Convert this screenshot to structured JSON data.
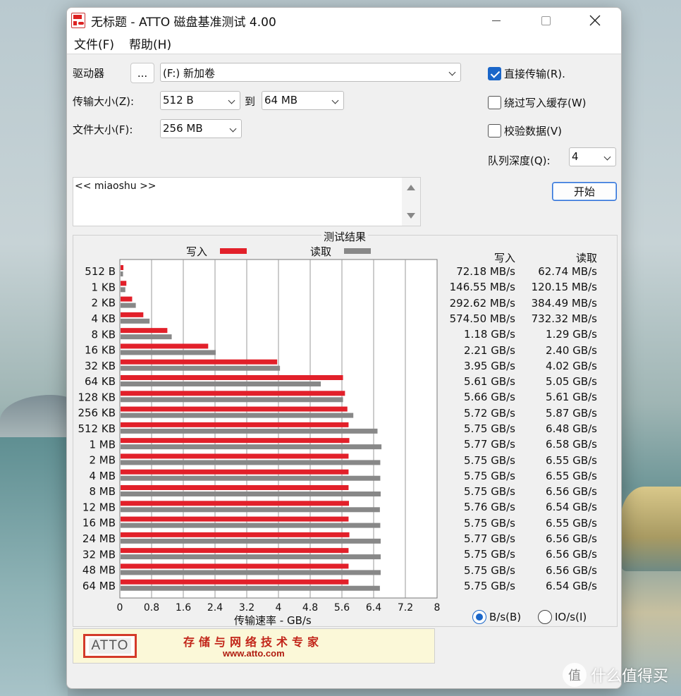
{
  "window": {
    "title": "无标题 - ATTO 磁盘基准测试 4.00"
  },
  "menu": [
    "文件(F)",
    "帮助(H)"
  ],
  "settings": {
    "drive_label": "驱动器",
    "drive_browse": "...",
    "drive_value": "(F:) 新加卷",
    "transfer_label": "传输大小(Z):",
    "transfer_from": "512 B",
    "transfer_to_label": "到",
    "transfer_to": "64 MB",
    "filesize_label": "文件大小(F):",
    "filesize_value": "256 MB",
    "direct_io": {
      "label": "直接传输(R).",
      "checked": true
    },
    "bypass_cache": {
      "label": "绕过写入缓存(W)",
      "checked": false
    },
    "verify": {
      "label": "校验数据(V)",
      "checked": false
    },
    "queue_label": "队列深度(Q):",
    "queue_value": "4",
    "start_label": "开始",
    "description": "<< miaoshu >>"
  },
  "results": {
    "title": "测试结果",
    "legend_write": "写入",
    "legend_read": "读取",
    "col_write": "写入",
    "col_read": "读取",
    "xlabel": "传输速率 - GB/s",
    "write_color": "#e2202a",
    "read_color": "#888888",
    "rows": [
      {
        "size": "512 B",
        "write": "72.18 MB/s",
        "read": "62.74 MB/s"
      },
      {
        "size": "1 KB",
        "write": "146.55 MB/s",
        "read": "120.15 MB/s"
      },
      {
        "size": "2 KB",
        "write": "292.62 MB/s",
        "read": "384.49 MB/s"
      },
      {
        "size": "4 KB",
        "write": "574.50 MB/s",
        "read": "732.32 MB/s"
      },
      {
        "size": "8 KB",
        "write": "1.18 GB/s",
        "read": "1.29 GB/s"
      },
      {
        "size": "16 KB",
        "write": "2.21 GB/s",
        "read": "2.40 GB/s"
      },
      {
        "size": "32 KB",
        "write": "3.95 GB/s",
        "read": "4.02 GB/s"
      },
      {
        "size": "64 KB",
        "write": "5.61 GB/s",
        "read": "5.05 GB/s"
      },
      {
        "size": "128 KB",
        "write": "5.66 GB/s",
        "read": "5.61 GB/s"
      },
      {
        "size": "256 KB",
        "write": "5.72 GB/s",
        "read": "5.87 GB/s"
      },
      {
        "size": "512 KB",
        "write": "5.75 GB/s",
        "read": "6.48 GB/s"
      },
      {
        "size": "1 MB",
        "write": "5.77 GB/s",
        "read": "6.58 GB/s"
      },
      {
        "size": "2 MB",
        "write": "5.75 GB/s",
        "read": "6.55 GB/s"
      },
      {
        "size": "4 MB",
        "write": "5.75 GB/s",
        "read": "6.55 GB/s"
      },
      {
        "size": "8 MB",
        "write": "5.75 GB/s",
        "read": "6.56 GB/s"
      },
      {
        "size": "12 MB",
        "write": "5.76 GB/s",
        "read": "6.54 GB/s"
      },
      {
        "size": "16 MB",
        "write": "5.75 GB/s",
        "read": "6.55 GB/s"
      },
      {
        "size": "24 MB",
        "write": "5.77 GB/s",
        "read": "6.56 GB/s"
      },
      {
        "size": "32 MB",
        "write": "5.75 GB/s",
        "read": "6.56 GB/s"
      },
      {
        "size": "48 MB",
        "write": "5.75 GB/s",
        "read": "6.56 GB/s"
      },
      {
        "size": "64 MB",
        "write": "5.75 GB/s",
        "read": "6.54 GB/s"
      }
    ],
    "unit_bytes": {
      "label": "B/s(B)",
      "selected": true
    },
    "unit_io": {
      "label": "IO/s(I)",
      "selected": false
    }
  },
  "chart_data": {
    "type": "bar",
    "orientation": "horizontal",
    "categories": [
      "512 B",
      "1 KB",
      "2 KB",
      "4 KB",
      "8 KB",
      "16 KB",
      "32 KB",
      "64 KB",
      "128 KB",
      "256 KB",
      "512 KB",
      "1 MB",
      "2 MB",
      "4 MB",
      "8 MB",
      "12 MB",
      "16 MB",
      "24 MB",
      "32 MB",
      "48 MB",
      "64 MB"
    ],
    "series": [
      {
        "name": "写入",
        "values": [
          0.07218,
          0.14655,
          0.29262,
          0.5745,
          1.18,
          2.21,
          3.95,
          5.61,
          5.66,
          5.72,
          5.75,
          5.77,
          5.75,
          5.75,
          5.75,
          5.76,
          5.75,
          5.77,
          5.75,
          5.75,
          5.75
        ]
      },
      {
        "name": "读取",
        "values": [
          0.06274,
          0.12015,
          0.38449,
          0.73232,
          1.29,
          2.4,
          4.02,
          5.05,
          5.61,
          5.87,
          6.48,
          6.58,
          6.55,
          6.55,
          6.56,
          6.54,
          6.55,
          6.56,
          6.56,
          6.56,
          6.54
        ]
      }
    ],
    "xticks": [
      "0",
      "0.8",
      "1.6",
      "2.4",
      "3.2",
      "4",
      "4.8",
      "5.6",
      "6.4",
      "7.2",
      "8"
    ],
    "xlim": [
      0,
      8
    ],
    "xlabel": "传输速率 - GB/s",
    "grid": true,
    "legend": "top"
  },
  "banner": {
    "logo": "ATTO",
    "slogan": "存储与网络技术专家",
    "url": "www.atto.com"
  },
  "watermark": {
    "glyph": "值",
    "text": "什么值得买"
  }
}
